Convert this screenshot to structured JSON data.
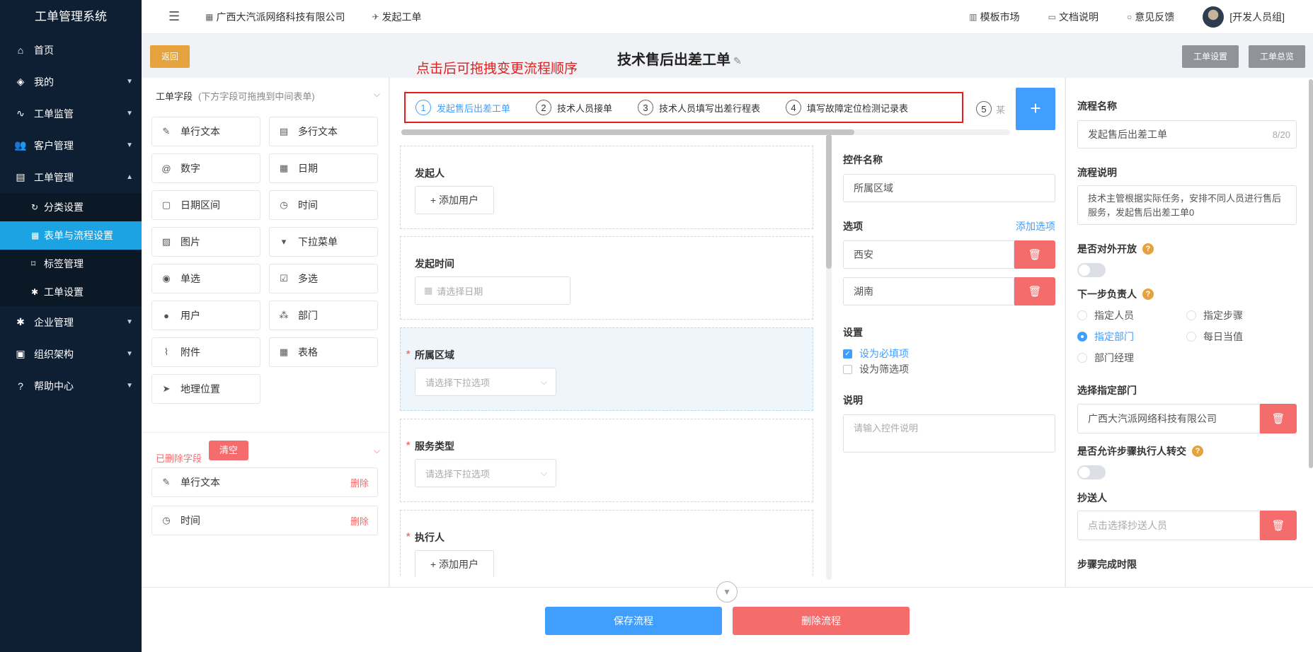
{
  "app": {
    "title": "工单管理系统"
  },
  "sidebar": {
    "items": [
      {
        "label": "首页",
        "icon": "home-icon"
      },
      {
        "label": "我的",
        "icon": "layers-icon"
      },
      {
        "label": "工单监管",
        "icon": "pulse-icon"
      },
      {
        "label": "客户管理",
        "icon": "users-icon"
      },
      {
        "label": "工单管理",
        "icon": "clipboard-icon"
      },
      {
        "label": "企业管理",
        "icon": "gear-icon"
      },
      {
        "label": "组织架构",
        "icon": "org-icon"
      },
      {
        "label": "帮助中心",
        "icon": "question-icon"
      }
    ],
    "sub_items": [
      {
        "label": "分类设置",
        "icon": "refresh-icon"
      },
      {
        "label": "表单与流程设置",
        "icon": "grid-icon"
      },
      {
        "label": "标签管理",
        "icon": "tag-icon"
      },
      {
        "label": "工单设置",
        "icon": "gear-icon"
      }
    ]
  },
  "header": {
    "company": "广西大汽派网络科技有限公司",
    "launch": "发起工单",
    "template_market": "模板市场",
    "docs": "文档说明",
    "feedback": "意见反馈",
    "user": "[开发人员组]"
  },
  "titlebar": {
    "back": "返回",
    "title": "技术售后出差工单",
    "hint": "点击后可拖拽变更流程顺序",
    "settings": "工单设置",
    "overview": "工单总览"
  },
  "left_panel": {
    "title": "工单字段",
    "subtitle": "(下方字段可拖拽到中间表单)",
    "fields": [
      {
        "label": "单行文本",
        "icon": "edit-icon"
      },
      {
        "label": "多行文本",
        "icon": "document-icon"
      },
      {
        "label": "数字",
        "icon": "at-icon"
      },
      {
        "label": "日期",
        "icon": "calendar-icon"
      },
      {
        "label": "日期区间",
        "icon": "calendar-range-icon"
      },
      {
        "label": "时间",
        "icon": "clock-icon"
      },
      {
        "label": "图片",
        "icon": "image-icon"
      },
      {
        "label": "下拉菜单",
        "icon": "dropdown-icon"
      },
      {
        "label": "单选",
        "icon": "radio-icon"
      },
      {
        "label": "多选",
        "icon": "checkbox-icon"
      },
      {
        "label": "用户",
        "icon": "user-icon"
      },
      {
        "label": "部门",
        "icon": "group-icon"
      },
      {
        "label": "附件",
        "icon": "paperclip-icon"
      },
      {
        "label": "表格",
        "icon": "table-icon"
      },
      {
        "label": "地理位置",
        "icon": "location-icon"
      }
    ],
    "deleted_title": "已删除字段",
    "clear": "清空",
    "deleted": [
      {
        "label": "单行文本",
        "icon": "edit-icon",
        "action": "删除"
      },
      {
        "label": "时间",
        "icon": "clock-icon",
        "action": "删除"
      }
    ]
  },
  "steps": [
    {
      "num": "1",
      "label": "发起售后出差工单"
    },
    {
      "num": "2",
      "label": "技术人员接单"
    },
    {
      "num": "3",
      "label": "技术人员填写出差行程表"
    },
    {
      "num": "4",
      "label": "填写故障定位检测记录表"
    },
    {
      "num": "5",
      "label": "某"
    }
  ],
  "form": [
    {
      "label": "发起人",
      "control": "+ 添加用户"
    },
    {
      "label": "发起时间",
      "control": "请选择日期"
    },
    {
      "label": "所属区域",
      "control": "请选择下拉选项"
    },
    {
      "label": "服务类型",
      "control": "请选择下拉选项"
    },
    {
      "label": "执行人",
      "control": "+ 添加用户"
    }
  ],
  "props": {
    "name_label": "控件名称",
    "name_value": "所属区域",
    "options_label": "选项",
    "add_option": "添加选项",
    "options": [
      "西安",
      "湖南"
    ],
    "settings_label": "设置",
    "required": "设为必填项",
    "filter": "设为筛选项",
    "desc_label": "说明",
    "desc_placeholder": "请输入控件说明"
  },
  "right_panel": {
    "flow_name_label": "流程名称",
    "flow_name": "发起售后出差工单",
    "flow_name_count": "8/20",
    "flow_desc_label": "流程说明",
    "flow_desc": "技术主管根据实际任务，安排不同人员进行售后服务，发起售后出差工单0",
    "public_label": "是否对外开放",
    "next_label": "下一步负责人",
    "radios": [
      "指定人员",
      "指定步骤",
      "指定部门",
      "每日当值",
      "部门经理"
    ],
    "dept_label": "选择指定部门",
    "dept_value": "广西大汽派网络科技有限公司",
    "transfer_label": "是否允许步骤执行人转交",
    "cc_label": "抄送人",
    "cc_placeholder": "点击选择抄送人员",
    "deadline_label": "步骤完成时限"
  },
  "footer": {
    "save": "保存流程",
    "delete": "删除流程"
  },
  "colors": {
    "sidebar": "#0e1f33",
    "accent": "#409eff",
    "danger": "#f56c6c",
    "warning": "#e6a23c",
    "active_nav": "#1ca3e3"
  }
}
